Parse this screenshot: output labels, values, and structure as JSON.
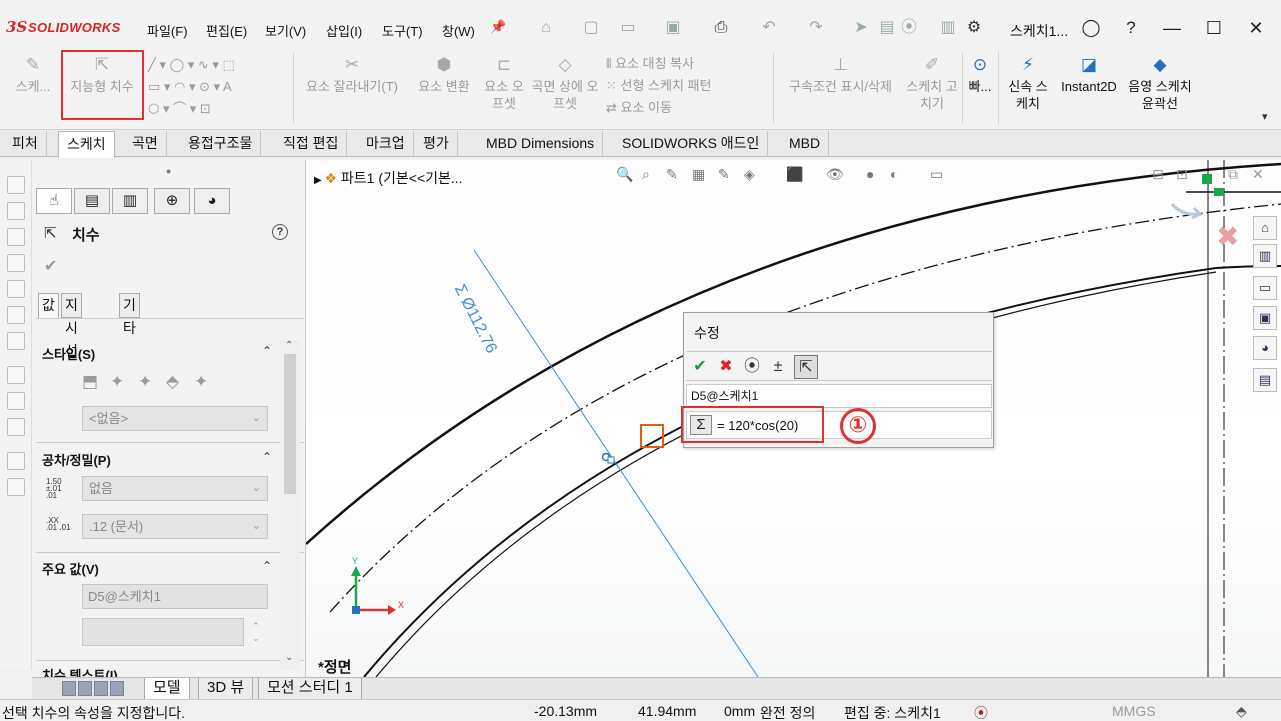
{
  "app": {
    "brand_prefix": "3S",
    "brand": "SOLIDWORKS",
    "menus": [
      "파일(F)",
      "편집(E)",
      "보기(V)",
      "삽입(I)",
      "도구(T)",
      "창(W)"
    ],
    "doc_title": "스케치1..."
  },
  "ribbon": {
    "sketch": "스케...",
    "smart_dimension": "지능형 치수",
    "trim": "요소 잘라내기(T)",
    "convert": "요소 변환",
    "offset_entities": "요소 오프셋",
    "offset_on_surface": "곡면 상에 오프셋",
    "mirror": "요소 대칭 복사",
    "linear_pattern": "선형 스케치 패턴",
    "move": "요소 이동",
    "relations": "구속조건 표시/삭제",
    "repair": "스케치 고치기",
    "quick": "빠...",
    "rapid_sketch": "신속 스케치",
    "instant2d": "Instant2D",
    "shaded_contours": "음영 스케치 윤곽선"
  },
  "tabs": [
    "피처",
    "스케치",
    "곡면",
    "용접구조물",
    "직접 편집",
    "마크업",
    "평가",
    "MBD Dimensions",
    "SOLIDWORKS 애드인",
    "MBD"
  ],
  "active_tab": "스케치",
  "pm": {
    "title": "치수",
    "subtabs": [
      "값",
      "지시선",
      "기타"
    ],
    "style_group": "스타일(S)",
    "style_select": "<없음>",
    "tolerance_group": "공차/정밀(P)",
    "tolerance_type": "없음",
    "tolerance_label": "1.50 ±.01 .01",
    "precision_label": ".XX .01 .01",
    "precision": ".12 (문서)",
    "primary_group": "주요 값(V)",
    "primary_name": "D5@스케치1",
    "dim_text_group": "치수 텍스트(I)"
  },
  "graphics": {
    "breadcrumb": "파트1  (기본<<기본...",
    "dimension_label": "Σ Ø112.76",
    "view_name": "*정면",
    "axis_x": "X",
    "axis_y": "Y"
  },
  "modify_dialog": {
    "title": "수정",
    "name": "D5@스케치1",
    "expression": "= 120*cos(20)",
    "sigma": "Σ",
    "badge": "①"
  },
  "bottom_tabs": [
    "모델",
    "3D 뷰",
    "모션 스터디 1"
  ],
  "status": {
    "message": "선택 치수의 속성을 지정합니다.",
    "x": "-20.13mm",
    "y": "41.94mm",
    "z": "0mm",
    "defined": "완전 정의",
    "editing": "편집 중: 스케치1",
    "units": "MMGS"
  },
  "colors": {
    "accent_red": "#e03030",
    "dimension_blue": "#3a8de0",
    "cursor_orange": "#e06010"
  }
}
